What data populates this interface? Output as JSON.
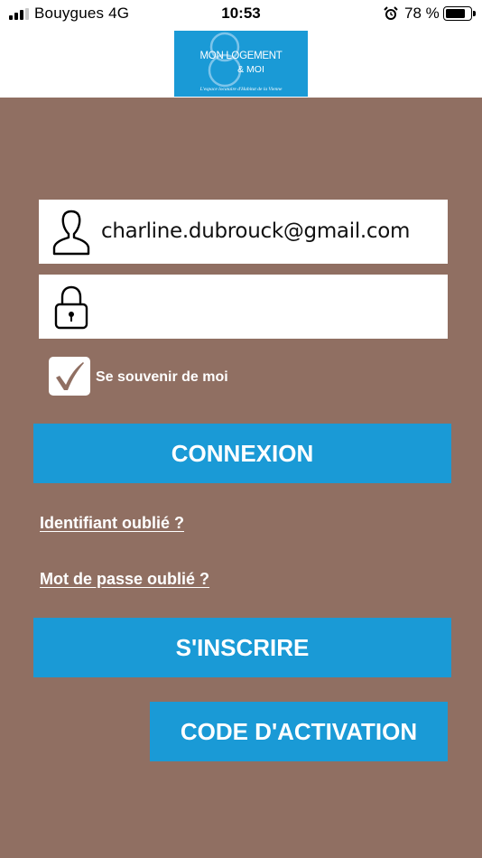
{
  "status_bar": {
    "carrier": "Bouygues  4G",
    "time": "10:53",
    "battery_percent": "78 %",
    "icons": [
      "signal-icon",
      "alarm-icon",
      "battery-icon"
    ]
  },
  "header": {
    "logo_title": "MON LOGEMENT",
    "logo_subtitle": "& MOI",
    "logo_tagline": "L'espace locataire d'Habitat de la Vienne"
  },
  "form": {
    "email_value": "charline.dubrouck@gmail.com",
    "password_value": "",
    "remember_label": "Se souvenir de moi",
    "remember_checked": true,
    "icons": {
      "user": "user-icon",
      "password": "lock-icon",
      "check": "checkmark-icon"
    }
  },
  "buttons": {
    "login": "CONNEXION",
    "register": "S'INSCRIRE",
    "activation": "CODE D'ACTIVATION"
  },
  "links": {
    "forgot_id": "Identifiant oublié ?",
    "forgot_password": "Mot de passe oublié ?"
  },
  "colors": {
    "background": "#906f62",
    "accent": "#1a9ad6",
    "field_bg": "#ffffff",
    "text_light": "#ffffff"
  }
}
